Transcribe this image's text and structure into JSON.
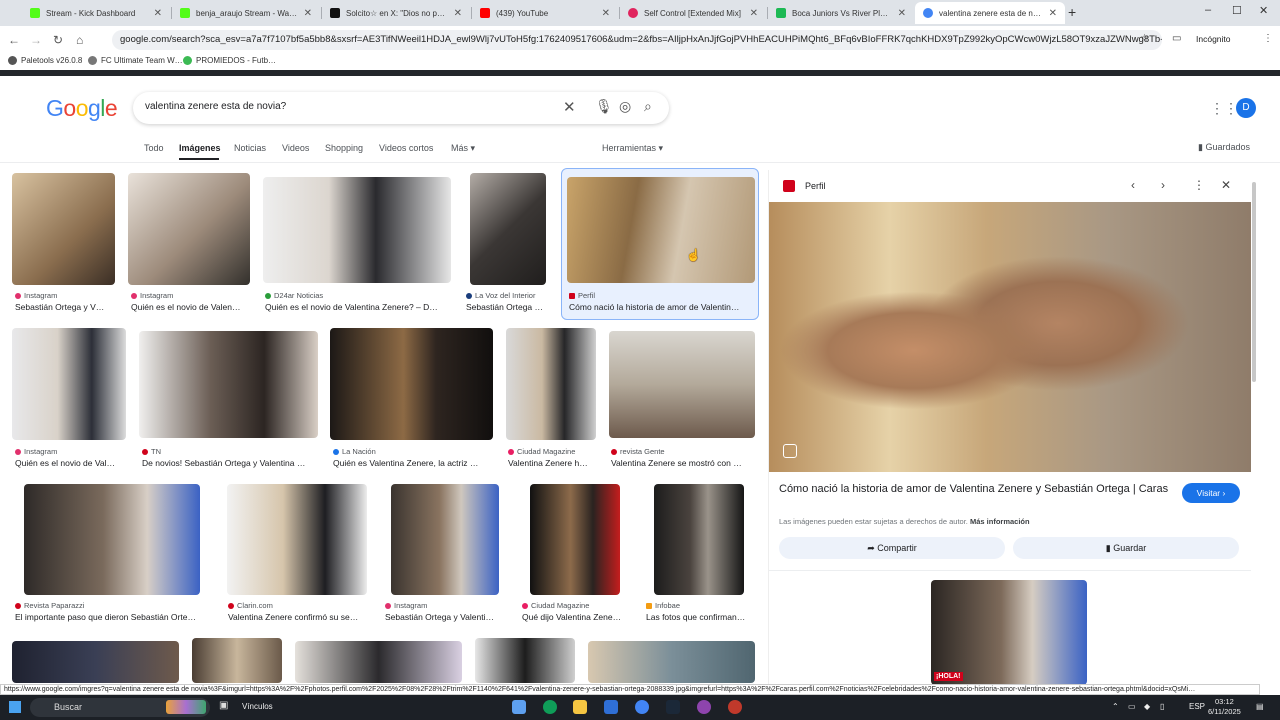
{
  "browser": {
    "tabs": [
      {
        "label": "Stream - Kick Dashboard",
        "color": "#53fc18",
        "active": false
      },
      {
        "label": "benja_araujo Stream - Watch Li…",
        "color": "#53fc18",
        "active": false
      },
      {
        "label": "Solcito☆ en X: \"Dios no puede…",
        "color": "#111111",
        "active": false
      },
      {
        "label": "(439) YouTube",
        "color": "#ff0000",
        "active": false
      },
      {
        "label": "Self Control [Extended Mix]",
        "color": "#e0245e",
        "active": false
      },
      {
        "label": "Boca Juniors Vs River Plate - Re…",
        "color": "#1db954",
        "active": false
      },
      {
        "label": "valentina zenere esta de novia?",
        "color": "#4285f4",
        "active": true
      }
    ],
    "new_tab": "+",
    "window_controls": [
      "–",
      "☐",
      "✕"
    ],
    "url": "google.com/search?sca_esv=a7a7f7107bf5a5bb8&sxsrf=AE3TifNWeeil1HDJA_ewl9Wlj7vUToH5fg:1762409517606&udm=2&fbs=AIljpHxAnJjfGojPVHhEACUHPiMQht6_BFq6vBIoFFRK7qchKHDX9TpZ992kyOpCWcw0WjzL58OT9xzaJZWNwg8Tb-KgwW85icPWFUM…",
    "incognito_label": "Incógnito",
    "bookmarks": [
      {
        "label": "Paletools v26.0.8",
        "color": "#555555"
      },
      {
        "label": "FC Ultimate Team W…",
        "color": "#777777"
      },
      {
        "label": "PROMIEDOS - Futb…",
        "color": "#3cba54"
      }
    ]
  },
  "google": {
    "logo": "Google",
    "query": "valentina zenere esta de novia?",
    "avatar_letter": "D",
    "filters": [
      "Todo",
      "Imágenes",
      "Noticias",
      "Videos",
      "Shopping",
      "Videos cortos",
      "Más ▾"
    ],
    "tools": "Herramientas ▾",
    "saved": "Guardados"
  },
  "results": [
    {
      "source": "Instagram",
      "title": "Sebastián Ortega y V…",
      "src_color": "#e1306c"
    },
    {
      "source": "Instagram",
      "title": "Quién es el novio de Valen…",
      "src_color": "#e1306c"
    },
    {
      "source": "D24ar Noticias",
      "title": "Quién es el novio de Valentina Zenere? – D…",
      "src_color": "#2a9d3a"
    },
    {
      "source": "La Voz del Interior",
      "title": "Sebastián Ortega …",
      "src_color": "#1a3d7c"
    },
    {
      "source": "Perfil",
      "title": "Cómo nació la historia de amor de Valentin…",
      "src_color": "#d0021b"
    },
    {
      "source": "Instagram",
      "title": "Quién es el novio de Val…",
      "src_color": "#e1306c"
    },
    {
      "source": "TN",
      "title": "De novios! Sebastián Ortega y Valentina …",
      "src_color": "#d0021b"
    },
    {
      "source": "La Nación",
      "title": "Quién es Valentina Zenere, la actriz …",
      "src_color": "#1a73e8"
    },
    {
      "source": "Ciudad Magazine",
      "title": "Valentina Zenere h…",
      "src_color": "#e91e63"
    },
    {
      "source": "revista Gente",
      "title": "Valentina Zenere se mostró con …",
      "src_color": "#d0021b"
    },
    {
      "source": "Revista Paparazzi",
      "title": "El importante paso que dieron Sebastián Orte…",
      "src_color": "#d0021b"
    },
    {
      "source": "Clarin.com",
      "title": "Valentina Zenere confirmó su se…",
      "src_color": "#d0021b"
    },
    {
      "source": "Instagram",
      "title": "Sebastián Ortega y Valenti…",
      "src_color": "#e1306c"
    },
    {
      "source": "Ciudad Magazine",
      "title": "Qué dijo Valentina Zene…",
      "src_color": "#e91e63"
    },
    {
      "source": "Infobae",
      "title": "Las fotos que confirman…",
      "src_color": "#f39c12"
    }
  ],
  "panel": {
    "source": "Perfil",
    "title": "Cómo nació la historia de amor de Valentina Zenere y Sebastián Ortega | Caras",
    "visit": "Visitar ›",
    "rights": "Las imágenes pueden estar sujetas a derechos de autor.",
    "more_info": "Más información",
    "share": "Compartir",
    "save": "Guardar",
    "related_badge": "¡HOLA!"
  },
  "status_url": "https://www.google.com/imgres?q=valentina zenere esta de novia%3F&imgurl=https%3A%2F%2Fphotos.perfil.com%2F2025%2F08%2F28%2Ftrim%2F1140%2F641%2Fvalentina-zenere-y-sebastian-ortega-2088339.jpg&imgrefurl=https%3A%2F%2Fcaras.perfil.com%2Fnoticias%2Fcelebridades%2Fcomo-nacio-historia-amor-valentina-zenere-sebastian-ortega.phtml&docid=xQsMi…",
  "taskbar": {
    "search": "Buscar",
    "label": "Vínculos",
    "lang": "ESP",
    "time": "03:12",
    "date": "6/11/2025"
  }
}
